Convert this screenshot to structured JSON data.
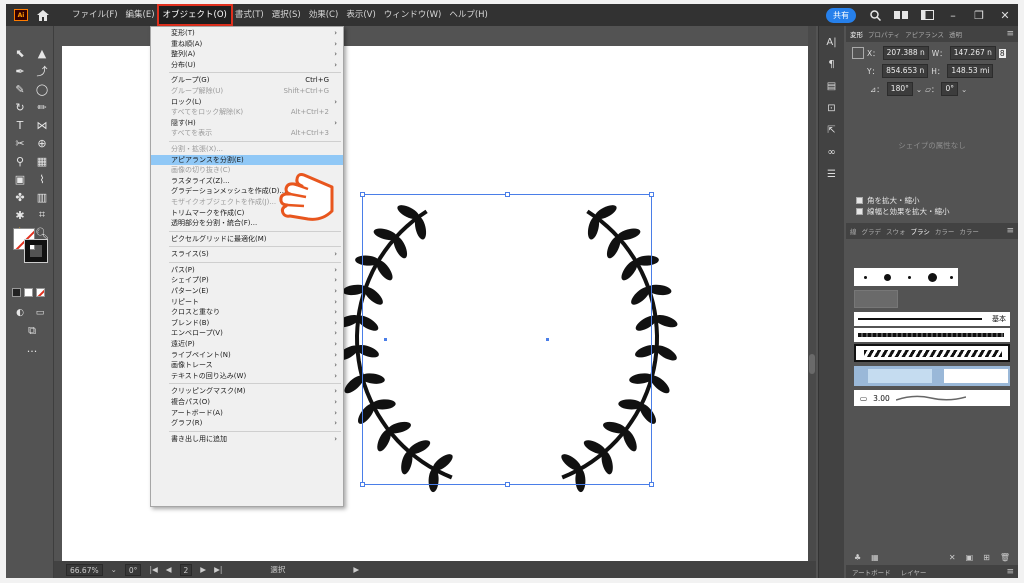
{
  "menubar": {
    "app_badge": "Ai",
    "items": [
      "ファイル(F)",
      "編集(E)",
      "オブジェクト(O)",
      "書式(T)",
      "選択(S)",
      "効果(C)",
      "表示(V)",
      "ウィンドウ(W)",
      "ヘルプ(H)"
    ],
    "active_index": 2,
    "share_label": "共有"
  },
  "object_menu": [
    {
      "label": "変形(T)",
      "submenu": true
    },
    {
      "label": "重ね順(A)",
      "submenu": true
    },
    {
      "label": "整列(A)",
      "submenu": true
    },
    {
      "label": "分布(U)",
      "submenu": true
    },
    {
      "sep": true
    },
    {
      "label": "グループ(G)",
      "shortcut": "Ctrl+G"
    },
    {
      "label": "グループ解除(U)",
      "shortcut": "Shift+Ctrl+G",
      "disabled": true
    },
    {
      "label": "ロック(L)",
      "submenu": true
    },
    {
      "label": "すべてをロック解除(K)",
      "shortcut": "Alt+Ctrl+2",
      "disabled": true
    },
    {
      "label": "隠す(H)",
      "submenu": true
    },
    {
      "label": "すべてを表示",
      "shortcut": "Alt+Ctrl+3",
      "disabled": true
    },
    {
      "sep": true
    },
    {
      "label": "分割・拡張(X)...",
      "disabled": true
    },
    {
      "label": "アピアランスを分割(E)",
      "highlight": true
    },
    {
      "label": "画像の切り抜き(C)",
      "disabled": true
    },
    {
      "label": "ラスタライズ(Z)..."
    },
    {
      "label": "グラデーションメッシュを作成(D)..."
    },
    {
      "label": "モザイクオブジェクトを作成(J)...",
      "disabled": true
    },
    {
      "label": "トリムマークを作成(C)"
    },
    {
      "label": "透明部分を分割・統合(F)..."
    },
    {
      "sep": true
    },
    {
      "label": "ピクセルグリッドに最適化(M)"
    },
    {
      "sep": true
    },
    {
      "label": "スライス(S)",
      "submenu": true
    },
    {
      "sep": true
    },
    {
      "label": "パス(P)",
      "submenu": true
    },
    {
      "label": "シェイプ(P)",
      "submenu": true
    },
    {
      "label": "パターン(E)",
      "submenu": true
    },
    {
      "label": "リピート",
      "submenu": true
    },
    {
      "label": "クロスと重なり",
      "submenu": true
    },
    {
      "label": "ブレンド(B)",
      "submenu": true
    },
    {
      "label": "エンベロープ(V)",
      "submenu": true
    },
    {
      "label": "遠近(P)",
      "submenu": true
    },
    {
      "label": "ライブペイント(N)",
      "submenu": true
    },
    {
      "label": "画像トレース",
      "submenu": true
    },
    {
      "label": "テキストの回り込み(W)",
      "submenu": true
    },
    {
      "sep": true
    },
    {
      "label": "クリッピングマスク(M)",
      "submenu": true
    },
    {
      "label": "複合パス(O)",
      "submenu": true
    },
    {
      "label": "アートボード(A)",
      "submenu": true
    },
    {
      "label": "グラフ(R)",
      "submenu": true
    },
    {
      "sep": true
    },
    {
      "label": "書き出し用に追加",
      "submenu": true
    }
  ],
  "panel": {
    "tabs": [
      "変形",
      "プロパティ",
      "アピアランス",
      "透明"
    ],
    "x_label": "X：",
    "x_value": "207.388 n",
    "w_label": "W：",
    "w_value": "147.267 n",
    "y_label": "Y：",
    "y_value": "854.653 n",
    "h_label": "H：",
    "h_value": "148.53 mi",
    "angle_value": "180°",
    "shear_value": "0°",
    "no_shape_props": "シェイプの属性なし",
    "scale_corners": "角を拡大・縮小",
    "scale_strokes": "線幅と効果を拡大・縮小",
    "tabs2": [
      "線",
      "グラデ",
      "スウォ",
      "ブラシ",
      "カラー",
      "カラー"
    ],
    "brush_basic": "基本",
    "brush_size": "3.00",
    "footer_tabs": [
      "アートボード",
      "レイヤー"
    ]
  },
  "status": {
    "zoom": "66.67%",
    "rotation": "0°",
    "artboard_num": "2",
    "tool_name": "選択"
  },
  "colors": {
    "accent_red": "#e0301e",
    "highlight_blue": "#90c8f6",
    "selection_blue": "#4a7ee8",
    "share_blue": "#2680eb"
  }
}
